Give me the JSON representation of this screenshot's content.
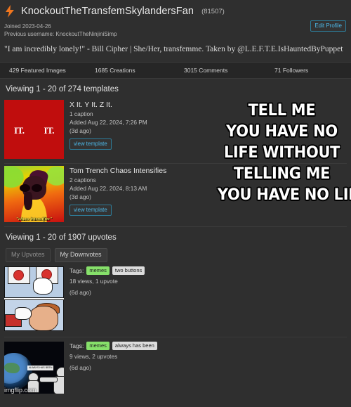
{
  "profile": {
    "avatar_icon": "lightning-bolt-icon",
    "username": "KnockoutTheTransfemSkylandersFan",
    "user_id": "(81507)",
    "joined": "Joined 2023-04-26",
    "previous_username": "Previous username: KnockoutTheNinjiniSimp",
    "edit_profile_label": "Edit Profile",
    "bio": "\"I am incredibly lonely!\" - Bill Cipher | She/Her, transfemme. Taken by @L.E.F.T.E.IsHauntedByPuppet",
    "accent_color": "#4db8e8"
  },
  "stats": [
    "429 Featured Images",
    "1685 Creations",
    "3015 Comments",
    "71 Followers"
  ],
  "templates_section": {
    "heading": "Viewing 1 - 20 of 274 templates",
    "items": [
      {
        "title": "X It. Y It. Z It.",
        "captions": "1 caption",
        "added": "Added Aug 22, 2024, 7:26 PM",
        "ago": "(3d ago)",
        "button_label": "view template",
        "thumb_text_1": "IT.",
        "thumb_text_2": "IT.",
        "thumb_color": "#c00d0d"
      },
      {
        "title": "Tom Trench Chaos Intensifies",
        "captions": "2 captions",
        "added": "Added Aug 22, 2024, 8:13 AM",
        "ago": "(3d ago)",
        "button_label": "view template",
        "thumb_caption": "\"chaos intensifies\""
      }
    ]
  },
  "upvotes_section": {
    "heading": "Viewing 1 - 20 of 1907 upvotes",
    "toggle": {
      "upvotes_label": "My Upvotes",
      "downvotes_label": "My Downvotes"
    },
    "items": [
      {
        "tags_label": "Tags:",
        "tags": [
          "memes",
          "two buttons"
        ],
        "stats": "18 views, 1 upvote",
        "ago": "(6d ago)"
      },
      {
        "tags_label": "Tags:",
        "tags": [
          "memes",
          "always has been"
        ],
        "stats": "9 views, 2 upvotes",
        "ago": "(6d ago)",
        "thumb_caption": "ALWAYS HAS BEEN",
        "watermark": "imgflip.com"
      }
    ]
  },
  "meme_overlay": {
    "lines": [
      "TELL ME",
      "YOU HAVE NO",
      "LIFE WITHOUT",
      "TELLING ME",
      "YOU HAVE NO LIFE"
    ]
  }
}
